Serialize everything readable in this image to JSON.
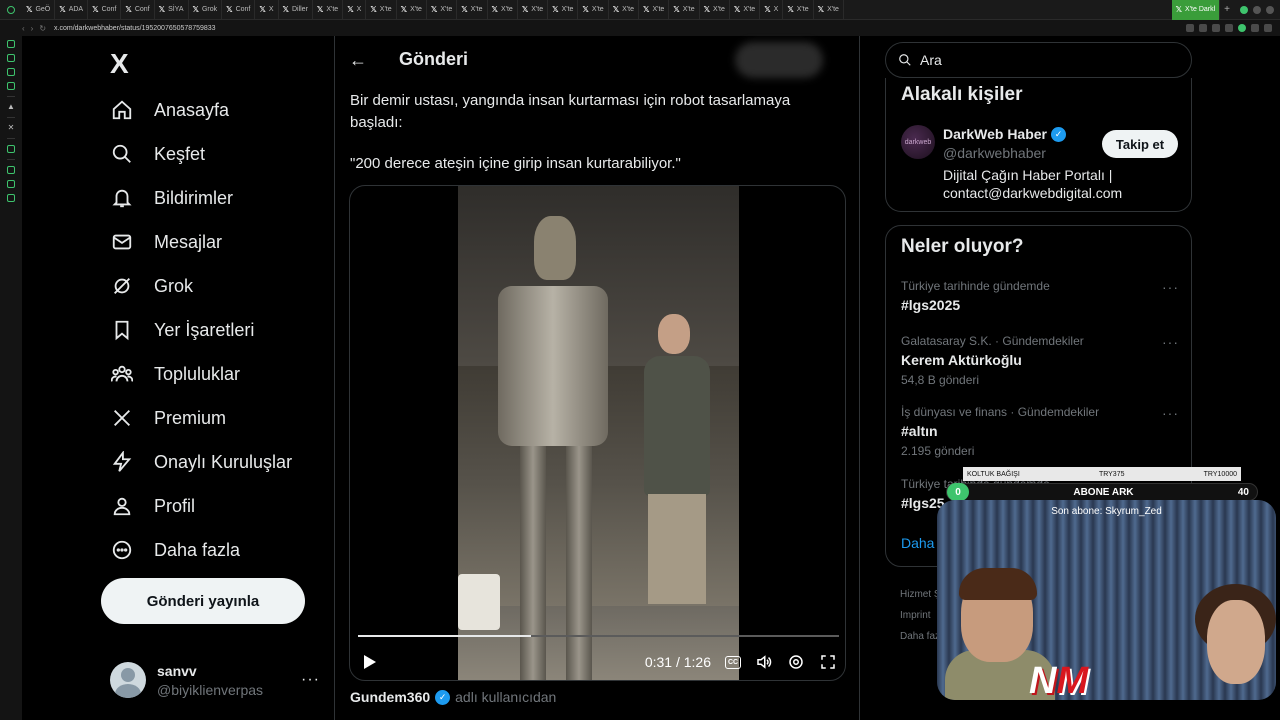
{
  "browser": {
    "tabs": [
      {
        "label": "GeÖ"
      },
      {
        "label": "ADA"
      },
      {
        "label": "Conf"
      },
      {
        "label": "Conf"
      },
      {
        "label": "SİYA"
      },
      {
        "label": "Grok"
      },
      {
        "label": "Conf"
      },
      {
        "label": "X"
      },
      {
        "label": "Diller"
      },
      {
        "label": "X'te"
      },
      {
        "label": "X"
      },
      {
        "label": "X'te"
      },
      {
        "label": "X'te"
      },
      {
        "label": "X'te"
      },
      {
        "label": "X'te"
      },
      {
        "label": "X'te"
      },
      {
        "label": "X'te"
      },
      {
        "label": "X'te"
      },
      {
        "label": "X'te"
      },
      {
        "label": "X'te"
      },
      {
        "label": "X'te"
      },
      {
        "label": "X'te"
      },
      {
        "label": "X'te"
      },
      {
        "label": "X'te"
      },
      {
        "label": "X"
      },
      {
        "label": "X'te"
      },
      {
        "label": "X'te"
      }
    ],
    "active_tab": "X'te Darkl",
    "url": "x.com/darkwebhaber/status/1952007650578759833",
    "accent": "#3ec46d"
  },
  "nav": {
    "logo": "X",
    "items": [
      {
        "label": "Anasayfa",
        "icon": "home-icon"
      },
      {
        "label": "Keşfet",
        "icon": "search-icon"
      },
      {
        "label": "Bildirimler",
        "icon": "bell-icon"
      },
      {
        "label": "Mesajlar",
        "icon": "mail-icon"
      },
      {
        "label": "Grok",
        "icon": "grok-icon"
      },
      {
        "label": "Yer İşaretleri",
        "icon": "bookmark-icon"
      },
      {
        "label": "Topluluklar",
        "icon": "people-icon"
      },
      {
        "label": "Premium",
        "icon": "x-premium-icon"
      },
      {
        "label": "Onaylı Kuruluşlar",
        "icon": "lightning-icon"
      },
      {
        "label": "Profil",
        "icon": "person-icon"
      },
      {
        "label": "Daha fazla",
        "icon": "more-circle-icon"
      }
    ],
    "post_button": "Gönderi yayınla",
    "account": {
      "name": "sanvv",
      "handle": "@biyiklienverpas"
    }
  },
  "main": {
    "title": "Gönderi",
    "text": "Bir demir ustası, yangında insan kurtarması için robot tasarlamaya başladı:",
    "quote": "\"200 derece ateşin içine girip insan kurtarabiliyor.\"",
    "video": {
      "time": "0:31 / 1:26",
      "progress": 0.36,
      "cc": "CC"
    },
    "source": {
      "name": "Gundem360",
      "suffix": "adlı kullanıcıdan"
    }
  },
  "right": {
    "search_placeholder": "Ara",
    "related_title": "Alakalı kişiler",
    "related": {
      "name": "DarkWeb Haber",
      "handle": "@darkwebhaber",
      "bio": "Dijital Çağın Haber Portalı | contact@darkwebdigital.com",
      "follow": "Takip et",
      "avatar_text": "darkweb"
    },
    "trends_title": "Neler oluyor?",
    "trends": [
      {
        "context": "Türkiye tarihinde gündemde",
        "name": "#lgs2025",
        "count": ""
      },
      {
        "context": "Galatasaray S.K. · Gündemdekiler",
        "name": "Kerem Aktürkoğlu",
        "count": "54,8 B gönderi"
      },
      {
        "context": "İş dünyası ve finans · Gündemdekiler",
        "name": "#altın",
        "count": "2.195 gönderi"
      },
      {
        "context": "Türkiye tarihinde gündemde",
        "name": "#lgs25",
        "count": ""
      }
    ],
    "show_more": "Daha fazla göster",
    "footer": [
      "Hizmet Şartları",
      "Imprint",
      "Daha fazla"
    ]
  },
  "overlay": {
    "bar_left": "KOLTUK BAĞIŞI",
    "bar_mid": "TRY375",
    "bar_right": "TRY10000",
    "sub_count": "0",
    "sub_label": "ABONE ARK",
    "sub_goal": "40",
    "last_sub": "Son abone: Skyrum_Zed",
    "brand_left": "N",
    "brand_right": "M"
  }
}
